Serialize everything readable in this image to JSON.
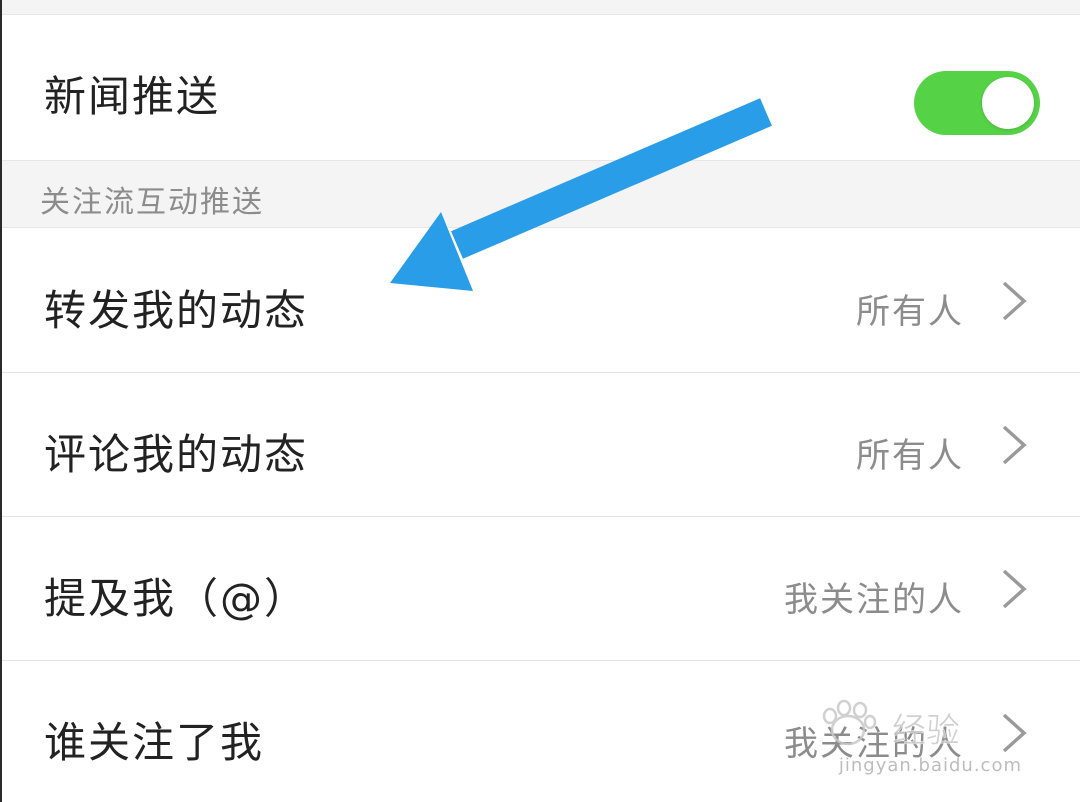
{
  "news_push": {
    "label": "新闻推送",
    "toggle_on": true,
    "toggle_color": "#56d246"
  },
  "section": {
    "title": "关注流互动推送"
  },
  "items": [
    {
      "label": "转发我的动态",
      "value": "所有人",
      "icon": "chevron-right-icon"
    },
    {
      "label": "评论我的动态",
      "value": "所有人",
      "icon": "chevron-right-icon"
    },
    {
      "label": "提及我（@）",
      "value": "我关注的人",
      "icon": "chevron-right-icon"
    },
    {
      "label": "谁关注了我",
      "value": "我关注的人",
      "icon": "chevron-right-icon"
    }
  ],
  "annotation": {
    "arrow_color": "#2a9de8"
  },
  "watermark": {
    "text": "Bai 经验",
    "sub": "jingyan.baidu.com"
  }
}
